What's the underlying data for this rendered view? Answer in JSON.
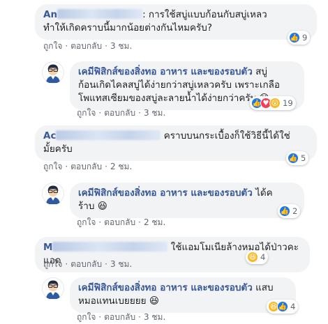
{
  "comments": [
    {
      "author_visible": "An",
      "text_line1": ": การใช้สบู่แบบก้อนกับสบู่เหลว",
      "text_line2": "ทำให้เกิดคราบนี้มากน้อยต่างกันไหมครับ?",
      "like": "ถูกใจ",
      "reply": "ตอบกลับ",
      "time": "3 ชม.",
      "reaction_count": "9"
    },
    {
      "author": "เคมีฟิสิกส์ของสิ่งทอ อาหาร และของรอบตัว",
      "text_line1": "สบู่",
      "text_line2": "ก้อนเกิดไคลสบู่ได้ง่ายกว่าสบู่เหลวครับ เพราะเกลือ",
      "text_line3": "โพแทสเซียมของสบู่ละลายน้ำได้ง่ายกว่าครับ",
      "emoji": "😆",
      "like": "ถูกใจ",
      "reply": "ตอบกลับ",
      "time": "3 ชม.",
      "reaction_count": "19"
    },
    {
      "author_visible": "Ac",
      "text_line1": "คราบบนกระเบื้องก็ใช้วิธีนี้ได้ใช่",
      "text_line2": "มั้ยครับ",
      "like": "ถูกใจ",
      "reply": "ตอบกลับ",
      "time": "2 ชม.",
      "reaction_count": "5"
    },
    {
      "author": "เคมีฟิสิกส์ของสิ่งทอ อาหาร และของรอบตัว",
      "text_line1": "ได้ค",
      "text_line2": "ร้าบ",
      "emoji": "😆",
      "like": "ถูกใจ",
      "reply": "ตอบกลับ",
      "time": "2 ชม.",
      "reaction_count": "2"
    },
    {
      "author_visible": "M",
      "text_line1": "ใช้แอมโมเนียล้างหมอได้ป่าวคะแอด",
      "like": "ถูกใจ",
      "reply": "ตอบกลับ",
      "time": "3 ชม.",
      "reaction_count": "4"
    },
    {
      "author": "เคมีฟิสิกส์ของสิ่งทอ อาหาร และของรอบตัว",
      "text_line1": "แสบ",
      "text_line2": "หมอแทนเบยยยย",
      "emoji": "😆",
      "like": "ถูกใจ",
      "reply": "ตอบกลับ",
      "time": "3 ชม.",
      "reaction_count": "4"
    }
  ],
  "icons": {
    "like": "thumbs-up-icon",
    "love": "heart-icon",
    "haha": "laughing-face-icon",
    "wow": "surprised-face-icon"
  },
  "colors": {
    "name": "#385898",
    "bubble": "#f2f3f5",
    "like": "#1877f2",
    "love": "#f33e58",
    "haha": "#f7b928"
  }
}
